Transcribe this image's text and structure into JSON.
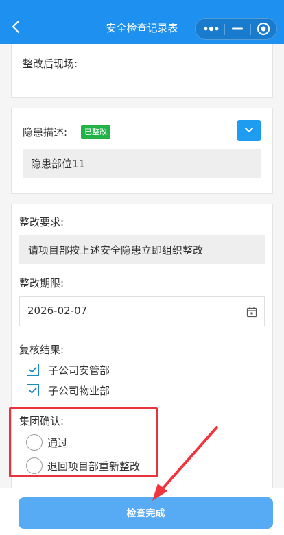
{
  "nav": {
    "title": "安全检查记录表",
    "back_icon": "chevron-left-icon",
    "capsule_icons": [
      "more-dots-icon",
      "minimize-icon",
      "target-circle-icon"
    ]
  },
  "section_after": {
    "label": "整改后现场:"
  },
  "section_hazard": {
    "label": "隐患描述:",
    "badge": "已整改",
    "badge_color": "#21b34a",
    "value": "隐患部位11",
    "toggle_icon": "chevron-down-icon"
  },
  "section_rectify": {
    "req_label": "整改要求:",
    "req_value": "请项目部按上述安全隐患立即组织整改",
    "deadline_label": "整改期限:",
    "deadline_value": "2026-02-07",
    "calendar_icon": "calendar-icon",
    "review_label": "复核结果:",
    "review_options": [
      {
        "label": "子公司安管部",
        "checked": true
      },
      {
        "label": "子公司物业部",
        "checked": true
      }
    ],
    "group_label": "集团确认:",
    "group_options": [
      {
        "label": "通过",
        "checked": false
      },
      {
        "label": "退回项目部重新整改",
        "checked": false
      }
    ]
  },
  "footer": {
    "submit_label": "检查完成"
  },
  "colors": {
    "primary": "#1e90f0",
    "button": "#57abf5",
    "highlight": "#e8323c"
  }
}
